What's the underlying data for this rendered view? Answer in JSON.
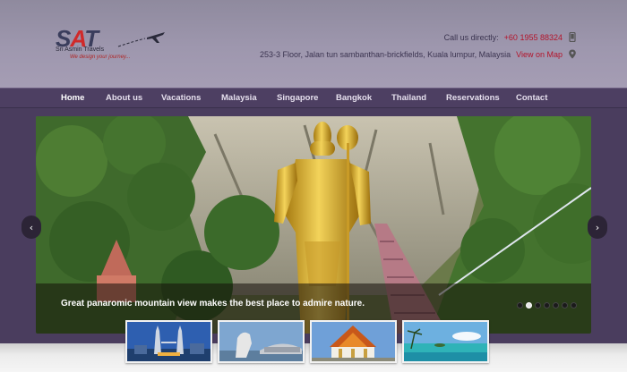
{
  "logo": {
    "mark_letters": [
      "S",
      "A",
      "T"
    ],
    "name": "Sri Asmin Travels",
    "tagline": "We design your journey..."
  },
  "contact": {
    "label": "Call us directly:",
    "phone": "+60 1955 88324",
    "address": "253-3 Floor, Jalan tun sambanthan-brickfields, Kuala lumpur, Malaysia",
    "map_link": "View on Map",
    "phone_icon": "phone-icon",
    "map_icon": "map-pin-icon"
  },
  "nav": {
    "items": [
      "Home",
      "About us",
      "Vacations",
      "Malaysia",
      "Singapore",
      "Bangkok",
      "Thailand",
      "Reservations",
      "Contact"
    ],
    "active": "Home"
  },
  "slider": {
    "caption": "Great panaromic mountain view makes the best place to admire nature.",
    "slide_count": 7,
    "active_slide": 2,
    "prev_arrow": "‹",
    "next_arrow": "›"
  },
  "thumbnails": [
    {
      "name": "petronas-towers"
    },
    {
      "name": "merlion"
    },
    {
      "name": "thai-temple"
    },
    {
      "name": "beach"
    }
  ],
  "colors": {
    "accent_red": "#b3142b",
    "nav_bg": "#4d3f62",
    "header_bg": "#9e97ae"
  }
}
